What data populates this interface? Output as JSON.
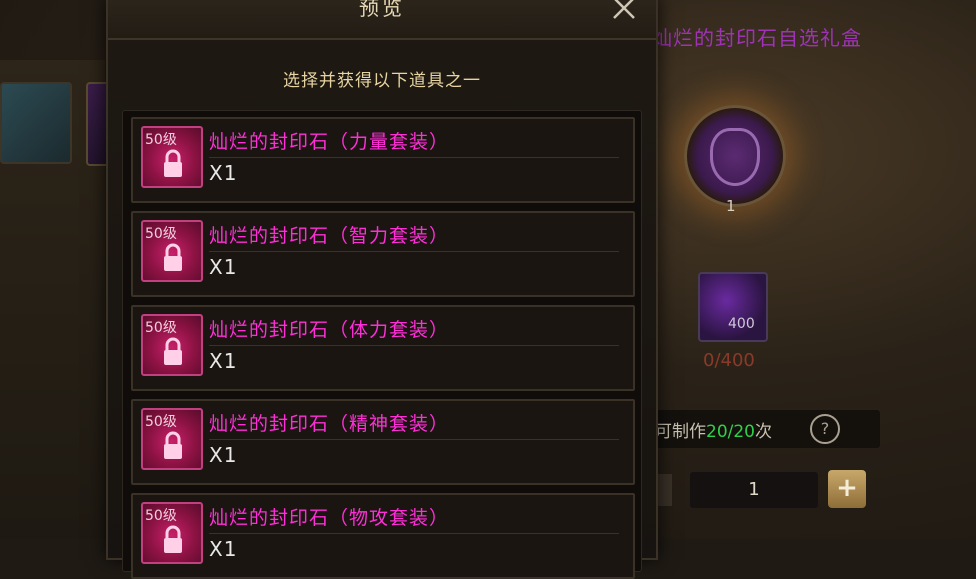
{
  "background": {
    "title": "灿烂的封印石自选礼盒",
    "emblem_count": "1",
    "material_count": "400",
    "material_progress": "0/400",
    "craft_prefix": "可制作",
    "craft_count": "20/20",
    "craft_suffix": "次",
    "quantity": "1",
    "plus_label": "+"
  },
  "dialog": {
    "title": "预览",
    "subtitle": "选择并获得以下道具之一",
    "items": [
      {
        "level": "50级",
        "name": "灿烂的封印石（力量套装）",
        "qty": "X1"
      },
      {
        "level": "50级",
        "name": "灿烂的封印石（智力套装）",
        "qty": "X1"
      },
      {
        "level": "50级",
        "name": "灿烂的封印石（体力套装）",
        "qty": "X1"
      },
      {
        "level": "50级",
        "name": "灿烂的封印石（精神套装）",
        "qty": "X1"
      },
      {
        "level": "50级",
        "name": "灿烂的封印石（物攻套装）",
        "qty": "X1"
      }
    ]
  },
  "colors": {
    "item_name": "#ff2ed8",
    "craft_count": "#2fd04a",
    "title": "#e8d9b6"
  },
  "icons": [
    "close-icon",
    "lock-icon",
    "help-icon",
    "plus-icon"
  ]
}
